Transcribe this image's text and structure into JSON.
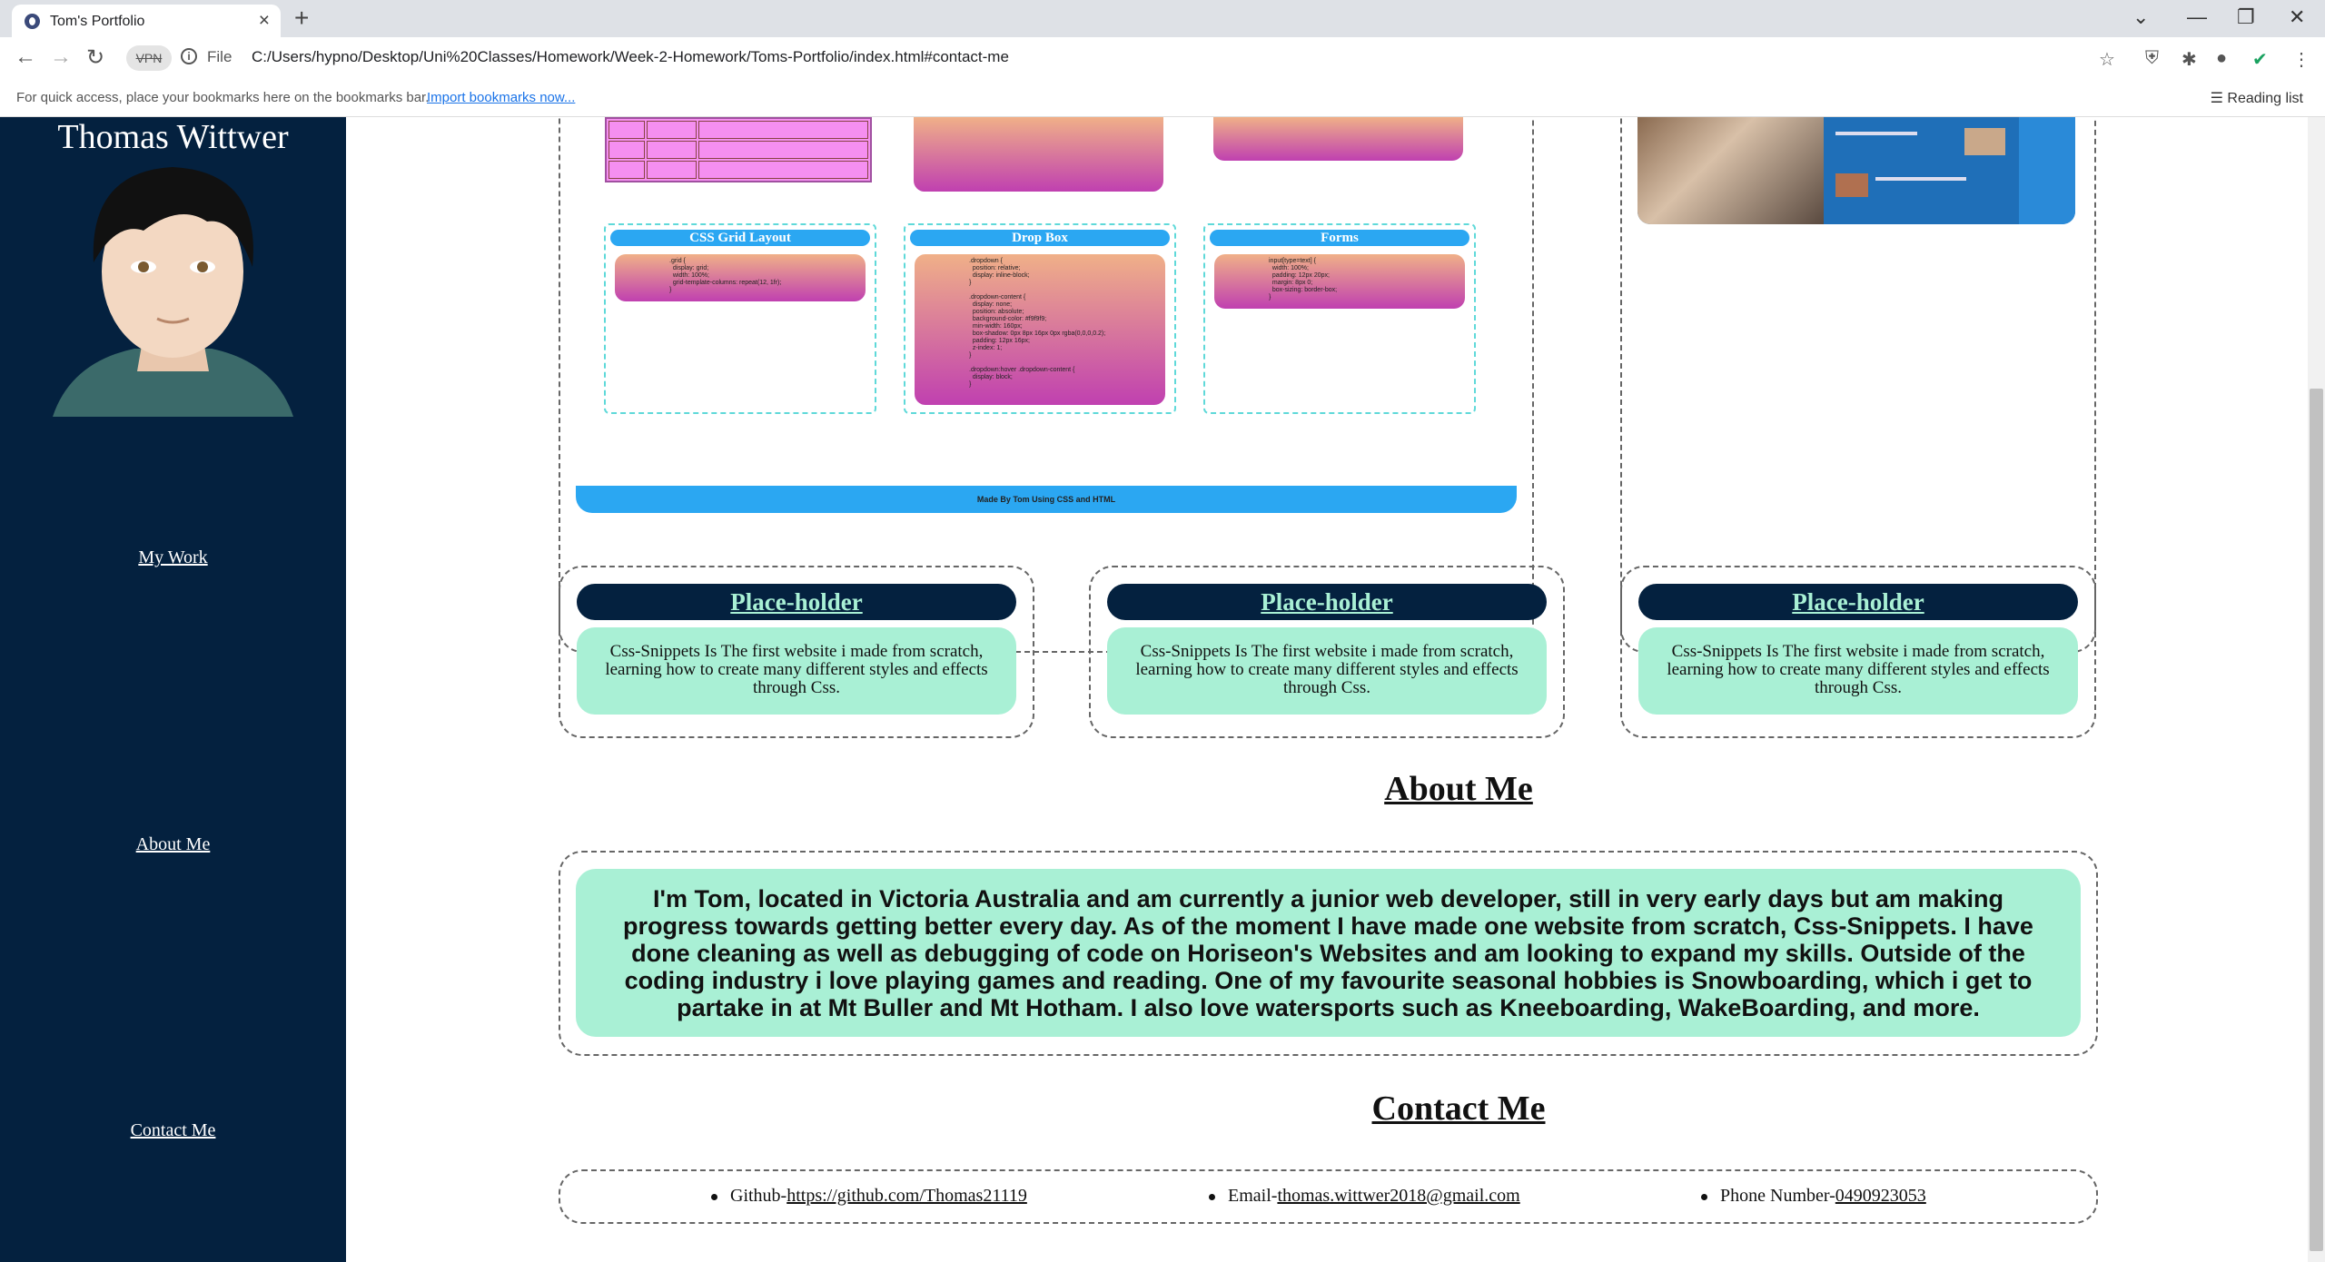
{
  "browser": {
    "tab_title": "Tom's Portfolio",
    "file_label": "File",
    "vpn_label": "VPN",
    "url": "C:/Users/hypno/Desktop/Uni%20Classes/Homework/Week-2-Homework/Toms-Portfolio/index.html#contact-me",
    "bookmarks_hint": "For quick access, place your bookmarks here on the bookmarks bar.",
    "import_bookmarks": "Import bookmarks now...",
    "reading_list": "Reading list"
  },
  "sidebar": {
    "name": "Thomas Wittwer",
    "links": [
      "My Work",
      "About Me",
      "Contact Me"
    ]
  },
  "project": {
    "cards": [
      {
        "title": "CSS Grid Layout",
        "code": ".grid {\n  display: grid;\n  width: 100%;\n  grid-template-columns: repeat(12, 1fr);\n}"
      },
      {
        "title": "Drop Box",
        "code": ".dropdown {\n  position: relative;\n  display: inline-block;\n}\n\n.dropdown-content {\n  display: none;\n  position: absolute;\n  background-color: #f9f9f9;\n  min-width: 160px;\n  box-shadow: 0px 8px 16px 0px rgba(0,0,0,0.2);\n  padding: 12px 16px;\n  z-index: 1;\n}\n\n.dropdown:hover .dropdown-content {\n  display: block;\n}"
      },
      {
        "title": "Forms",
        "code": "input[type=text] {\n  width: 100%;\n  padding: 12px 20px;\n  margin: 8px 0;\n  box-sizing: border-box;\n}"
      }
    ],
    "footer": "Made By Tom Using CSS and HTML"
  },
  "placeholders": [
    {
      "title": "Place-holder",
      "text": "Css-Snippets Is The first website i made from scratch, learning how to create many different styles and effects through Css."
    },
    {
      "title": "Place-holder",
      "text": "Css-Snippets Is The first website i made from scratch, learning how to create many different styles and effects through Css."
    },
    {
      "title": "Place-holder",
      "text": "Css-Snippets Is The first website i made from scratch, learning how to create many different styles and effects through Css."
    }
  ],
  "about": {
    "title": "About Me",
    "text": "I'm Tom, located in Victoria Australia and am currently a junior web developer, still in very early days but am making progress towards getting better every day. As of the moment I have made one website from scratch, Css-Snippets. I have done cleaning as well as debugging of code on Horiseon's Websites and am looking to expand my skills. Outside of the coding industry i love playing games and reading. One of my favourite seasonal hobbies is Snowboarding, which i get to partake in at Mt Buller and Mt Hotham. I also love watersports such as Kneeboarding, WakeBoarding, and more."
  },
  "contact": {
    "title": "Contact Me",
    "github_label": "Github-",
    "github_link": "https://github.com/Thomas21119",
    "email_label": "Email-",
    "email_link": "thomas.wittwer2018@gmail.com",
    "phone_label": "Phone Number-",
    "phone_link": "0490923053"
  }
}
